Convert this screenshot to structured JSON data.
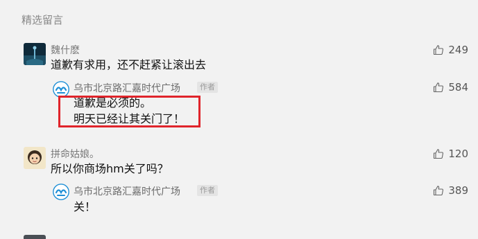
{
  "section": {
    "title": "精选留言"
  },
  "comments": [
    {
      "nickname": "魏什麽",
      "text": "道歉有求用，还不赶紧让滚出去",
      "likes": "249",
      "reply": {
        "author": "乌市北京路汇嘉时代广场",
        "tag": "作者",
        "likes": "584",
        "lines": [
          "道歉是必须的。",
          "明天已经让其关门了！"
        ]
      }
    },
    {
      "nickname": "拼命姑娘。",
      "text": "所以你商场hm关了吗？",
      "likes": "120",
      "reply": {
        "author": "乌市北京路汇嘉时代广场",
        "tag": "作者",
        "likes": "389",
        "lines": [
          "关！"
        ]
      }
    }
  ],
  "colors": {
    "highlight": "#e0242b",
    "author_logo": "#1e8fd6",
    "page_bg": "#f2f2f2"
  }
}
